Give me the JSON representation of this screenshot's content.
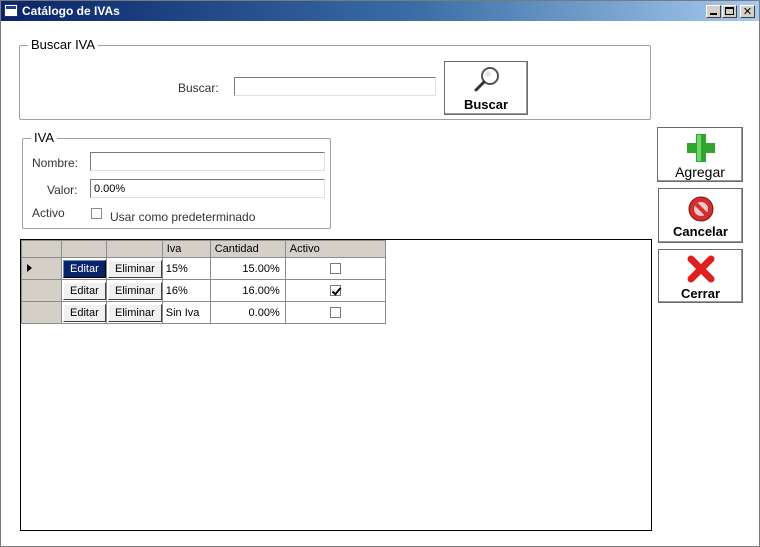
{
  "window": {
    "title": "Catálogo de IVAs"
  },
  "search": {
    "group_title": "Buscar IVA",
    "label": "Buscar:",
    "value": "",
    "button_label": "Buscar"
  },
  "iva": {
    "group_title": "IVA",
    "nombre_label": "Nombre:",
    "nombre_value": "",
    "valor_label": "Valor:",
    "valor_value": "0.00%",
    "activo_label": "Activo",
    "default_checkbox_label": "Usar como predeterminado",
    "default_checked": false
  },
  "actions": {
    "agregar_label": "Agregar",
    "cancelar_label": "Cancelar",
    "cerrar_label": "Cerrar"
  },
  "grid": {
    "columns": [
      "",
      "",
      "Iva",
      "Cantidad",
      "Activo"
    ],
    "rows": [
      {
        "edit": "Editar",
        "delete": "Eliminar",
        "iva": "15%",
        "cantidad": "15.00%",
        "activo": false,
        "current": true
      },
      {
        "edit": "Editar",
        "delete": "Eliminar",
        "iva": "16%",
        "cantidad": "16.00%",
        "activo": true,
        "current": false
      },
      {
        "edit": "Editar",
        "delete": "Eliminar",
        "iva": "Sin Iva",
        "cantidad": "0.00%",
        "activo": false,
        "current": false
      }
    ]
  },
  "colors": {
    "title_bar_start": "#0a246a",
    "title_bar_end": "#a6caf0",
    "add_icon": "#2fa52f",
    "cancel_icon": "#d03030",
    "close_icon": "#e02020"
  },
  "icons": {
    "search": "magnifier-icon",
    "add": "plus-icon",
    "cancel": "cancel-icon",
    "close": "close-x-icon"
  }
}
